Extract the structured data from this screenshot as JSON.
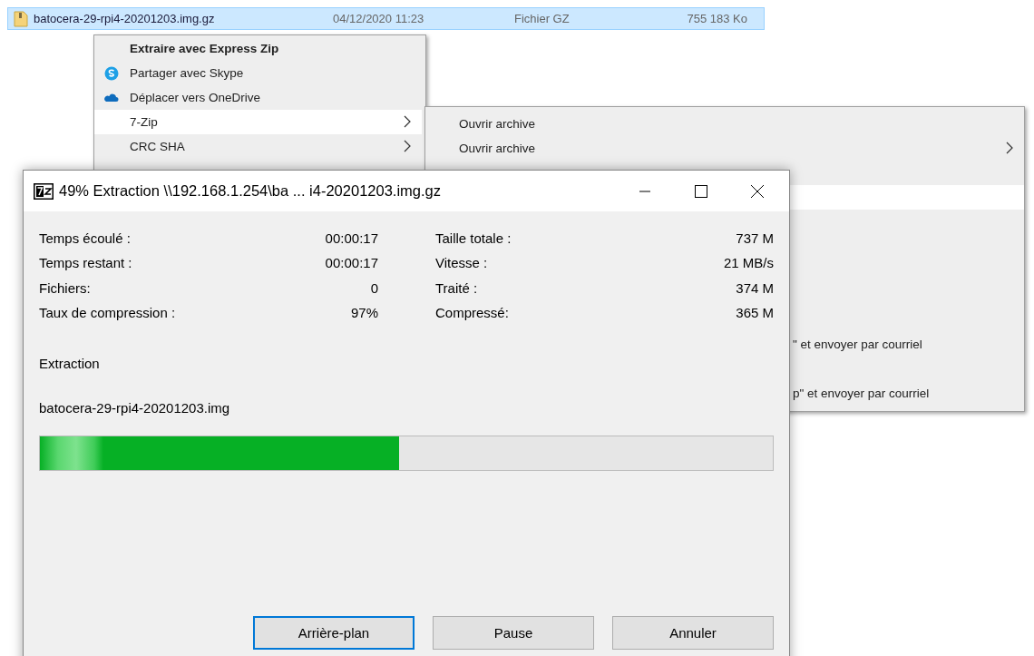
{
  "explorer_row": {
    "name": "batocera-29-rpi4-20201203.img.gz",
    "date": "04/12/2020 11:23",
    "type": "Fichier GZ",
    "size": "755 183 Ko",
    "selected": true
  },
  "context_menu": {
    "items": [
      {
        "label": "Extraire avec Express Zip",
        "kind": "plain",
        "default": true,
        "selected": false,
        "has_submenu": false
      },
      {
        "label": "Partager avec Skype",
        "kind": "skype",
        "default": false,
        "selected": false,
        "has_submenu": false
      },
      {
        "label": "Déplacer vers OneDrive",
        "kind": "cloud",
        "default": false,
        "selected": false,
        "has_submenu": false
      },
      {
        "label": "7-Zip",
        "kind": "plain",
        "default": false,
        "selected": true,
        "has_submenu": true
      },
      {
        "label": "CRC SHA",
        "kind": "plain",
        "default": false,
        "selected": false,
        "has_submenu": true
      }
    ]
  },
  "submenu": {
    "items": [
      {
        "label": "Ouvrir archive",
        "selected": false,
        "has_submenu": false
      },
      {
        "label": "Ouvrir archive",
        "selected": false,
        "has_submenu": true
      },
      {
        "selected": true,
        "has_submenu": false
      },
      {
        "label": "\" et envoyer par courriel",
        "selected": false,
        "has_submenu": false
      },
      {
        "label": "p\" et envoyer par courriel",
        "selected": false,
        "has_submenu": false
      }
    ]
  },
  "dialog": {
    "title": "49% Extraction \\\\192.168.1.254\\ba ... i4-20201203.img.gz",
    "stats_left": [
      {
        "label": "Temps écoulé :",
        "value": "00:00:17"
      },
      {
        "label": "Temps restant :",
        "value": "00:00:17"
      },
      {
        "label": "Fichiers:",
        "value": "0"
      },
      {
        "label": "Taux de compression :",
        "value": "97%"
      }
    ],
    "stats_right": [
      {
        "label": "Taille totale :",
        "value": "737 M"
      },
      {
        "label": "Vitesse :",
        "value": "21 MB/s"
      },
      {
        "label": "Traité :",
        "value": "374 M"
      },
      {
        "label": "Compressé:",
        "value": "365 M"
      }
    ],
    "operation": "Extraction",
    "current_file": "batocera-29-rpi4-20201203.img",
    "progress": {
      "level": 0.49
    },
    "buttons": [
      {
        "label": "Arrière-plan",
        "default": true
      },
      {
        "label": "Pause",
        "default": false
      },
      {
        "label": "Annuler",
        "default": false
      }
    ]
  }
}
